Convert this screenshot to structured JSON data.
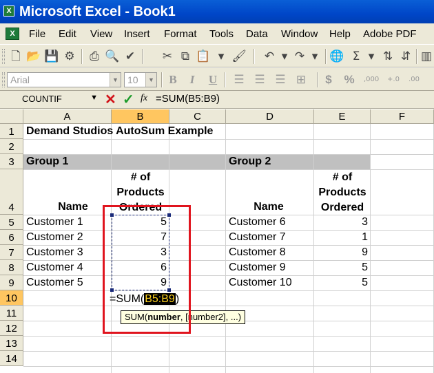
{
  "window": {
    "title": "Microsoft Excel - Book1"
  },
  "menu": [
    "File",
    "Edit",
    "View",
    "Insert",
    "Format",
    "Tools",
    "Data",
    "Window",
    "Help",
    "Adobe PDF"
  ],
  "font_box": {
    "font": "Arial",
    "size": "10"
  },
  "format_buttons": {
    "bold": "B",
    "italic": "I",
    "underline": "U",
    "currency": "$",
    "percent": "%",
    "sigma": "Σ"
  },
  "name_box": "COUNTIF",
  "formula": {
    "fx": "fx",
    "content": "=SUM(B5:B9)"
  },
  "columns": [
    "A",
    "B",
    "C",
    "D",
    "E",
    "F"
  ],
  "rows": [
    "1",
    "2",
    "3",
    "4",
    "5",
    "6",
    "7",
    "8",
    "9",
    "10",
    "11",
    "12",
    "13",
    "14"
  ],
  "sheet": {
    "title": "Demand Studios AutoSum Example",
    "group1": "Group 1",
    "group2": "Group 2",
    "hdr_name1": "Name",
    "hdr_prod1": [
      "# of",
      "Products",
      "Ordered"
    ],
    "hdr_name2": "Name",
    "hdr_prod2": [
      "# of",
      "Products",
      "Ordered"
    ],
    "group1_rows": [
      {
        "name": "Customer 1",
        "qty": "5"
      },
      {
        "name": "Customer 2",
        "qty": "7"
      },
      {
        "name": "Customer 3",
        "qty": "3"
      },
      {
        "name": "Customer 4",
        "qty": "6"
      },
      {
        "name": "Customer 5",
        "qty": "9"
      }
    ],
    "group2_rows": [
      {
        "name": "Customer 6",
        "qty": "3"
      },
      {
        "name": "Customer 7",
        "qty": "1"
      },
      {
        "name": "Customer 8",
        "qty": "9"
      },
      {
        "name": "Customer 9",
        "qty": "5"
      },
      {
        "name": "Customer 10",
        "qty": "5"
      }
    ]
  },
  "edit": {
    "prefix": "=SUM(",
    "ref": "B5:B9",
    "suffix": ")"
  },
  "tooltip": {
    "fn": "SUM(",
    "arg": "number",
    "rest": ", [number2], ...)"
  },
  "colors": {
    "title_bar": "#0046c8",
    "highlight_box": "#e0141e",
    "selected_header": "#ffc660",
    "group_band": "#c0c0c0"
  }
}
